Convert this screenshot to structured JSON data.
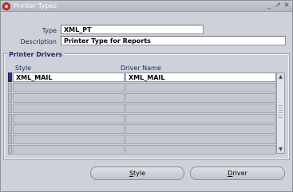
{
  "window": {
    "title": "Printer Types",
    "controls": [
      "_",
      "↗",
      "✕"
    ]
  },
  "form": {
    "type_label": "Type",
    "type_value": "XML_PT",
    "description_label": "Description",
    "description_value": "Printer Type for Reports"
  },
  "group": {
    "title": "Printer Drivers"
  },
  "table": {
    "columns": [
      "Style",
      "Driver Name"
    ],
    "rows": [
      [
        "XML_MAIL",
        "XML_MAIL"
      ],
      [
        "",
        ""
      ],
      [
        "",
        ""
      ],
      [
        "",
        ""
      ],
      [
        "",
        ""
      ],
      [
        "",
        ""
      ],
      [
        "",
        ""
      ],
      [
        "",
        ""
      ]
    ]
  },
  "buttons": {
    "style_prefix": "S",
    "style_rest": "tyle",
    "driver_prefix": "D",
    "driver_rest": "river"
  },
  "icons": {
    "app": "oracle-icon",
    "scroll_up": "scroll-up-icon",
    "scroll_down": "scroll-down-icon"
  }
}
